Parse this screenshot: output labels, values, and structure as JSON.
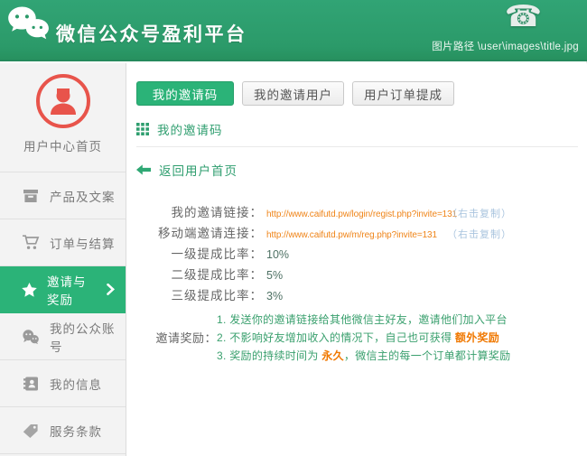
{
  "header": {
    "title": "微信公众号盈利平台",
    "image_path": "图片路径 \\user\\images\\title.jpg"
  },
  "sidebar": {
    "items": [
      {
        "label": "用户中心首页",
        "icon": "user-avatar-icon",
        "active": false
      },
      {
        "label": "产品及文案",
        "icon": "product-box-icon",
        "active": false
      },
      {
        "label": "订单与结算",
        "icon": "cart-icon",
        "active": false
      },
      {
        "label": "邀请与奖励",
        "icon": "star-icon",
        "active": true
      },
      {
        "label": "我的公众账号",
        "icon": "wechat-account-icon",
        "active": false
      },
      {
        "label": "我的信息",
        "icon": "contact-card-icon",
        "active": false
      },
      {
        "label": "服务条款",
        "icon": "tag-icon",
        "active": false
      }
    ]
  },
  "tabs": [
    {
      "label": "我的邀请码",
      "active": true
    },
    {
      "label": "我的邀请用户",
      "active": false
    },
    {
      "label": "用户订单提成",
      "active": false
    }
  ],
  "section_title": "我的邀请码",
  "back_link_label": "返回用户首页",
  "invite": {
    "rows": [
      {
        "label": "我的邀请链接：",
        "value": "http://www.caifutd.pw/login/regist.php?invite=131",
        "copy_hint": "（右击复制）"
      },
      {
        "label": "移动端邀请连接：",
        "value": "http://www.caifutd.pw/m/reg.php?invite=131",
        "copy_hint": "（右击复制）"
      },
      {
        "label": "一级提成比率：",
        "value": "10%"
      },
      {
        "label": "二级提成比率：",
        "value": "5%"
      },
      {
        "label": "三级提成比率：",
        "value": "3%"
      }
    ],
    "reward": {
      "label": "邀请奖励：",
      "lines": [
        {
          "prefix": "1. 发送你的邀请链接给其他微信主好友，邀请他们加入平台",
          "highlight": "",
          "suffix": ""
        },
        {
          "prefix": "2. 不影响好友增加收入的情况下，自己也可获得 ",
          "highlight": "额外奖励",
          "suffix": ""
        },
        {
          "prefix": "3. 奖励的持续时间为 ",
          "highlight": "永久",
          "suffix": "，微信主的每一个订单都计算奖励"
        }
      ]
    }
  },
  "colors": {
    "header_green": "#2b9a69",
    "accent_green": "#2bb378",
    "text_green": "#2f9e6f",
    "link_orange": "#ef8418",
    "highlight_orange": "#f07800",
    "copy_hint_blue": "#a9c4de",
    "user_icon_red": "#e8544b",
    "sidebar_bg": "#f3f3f3"
  }
}
